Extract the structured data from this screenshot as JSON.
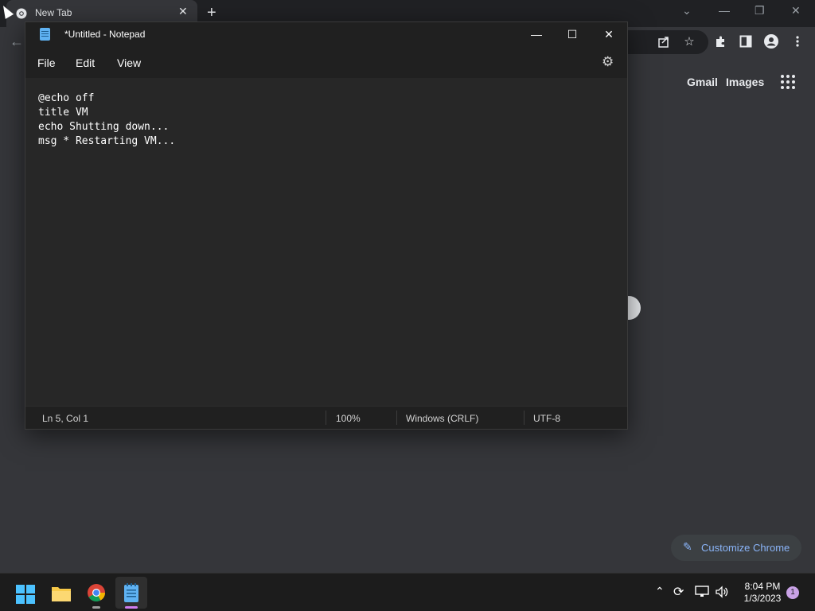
{
  "chrome": {
    "tab_title": "New Tab",
    "tab_close": "✕",
    "new_tab": "+",
    "window_controls": {
      "dropdown": "⌄",
      "minimize": "—",
      "restore": "❐",
      "close": "✕"
    },
    "toolbar_icons": [
      "share-icon",
      "star-icon",
      "extensions-icon",
      "side-panel-icon",
      "profile-icon",
      "menu-icon"
    ],
    "gmail": "Gmail",
    "images": "Images",
    "customize_label": "Customize Chrome",
    "customize_icon": "✎"
  },
  "notepad": {
    "title": "*Untitled - Notepad",
    "controls": {
      "minimize": "—",
      "maximize": "☐",
      "close": "✕"
    },
    "menu": [
      "File",
      "Edit",
      "View"
    ],
    "gear": "⚙",
    "content": "@echo off\ntitle VM\necho Shutting down...\nmsg * Restarting VM...",
    "status": {
      "position": "Ln 5, Col 1",
      "zoom": "100%",
      "line_ending": "Windows (CRLF)",
      "encoding": "UTF-8"
    }
  },
  "taskbar": {
    "apps": [
      "start-button",
      "file-explorer",
      "chrome",
      "notepad"
    ],
    "time": "8:04 PM",
    "date": "1/3/2023",
    "notifications": "1",
    "tray": {
      "chevron": "⌃",
      "sync": "⟳",
      "network": "🖧",
      "volume": "🔊"
    }
  },
  "colors": {
    "chrome_bg": "#35363a",
    "notepad_bg": "#272727",
    "taskbar_bg": "#1c1c1c",
    "accent_link": "#8ab4f8",
    "notepad_accent": "#d07df0"
  }
}
